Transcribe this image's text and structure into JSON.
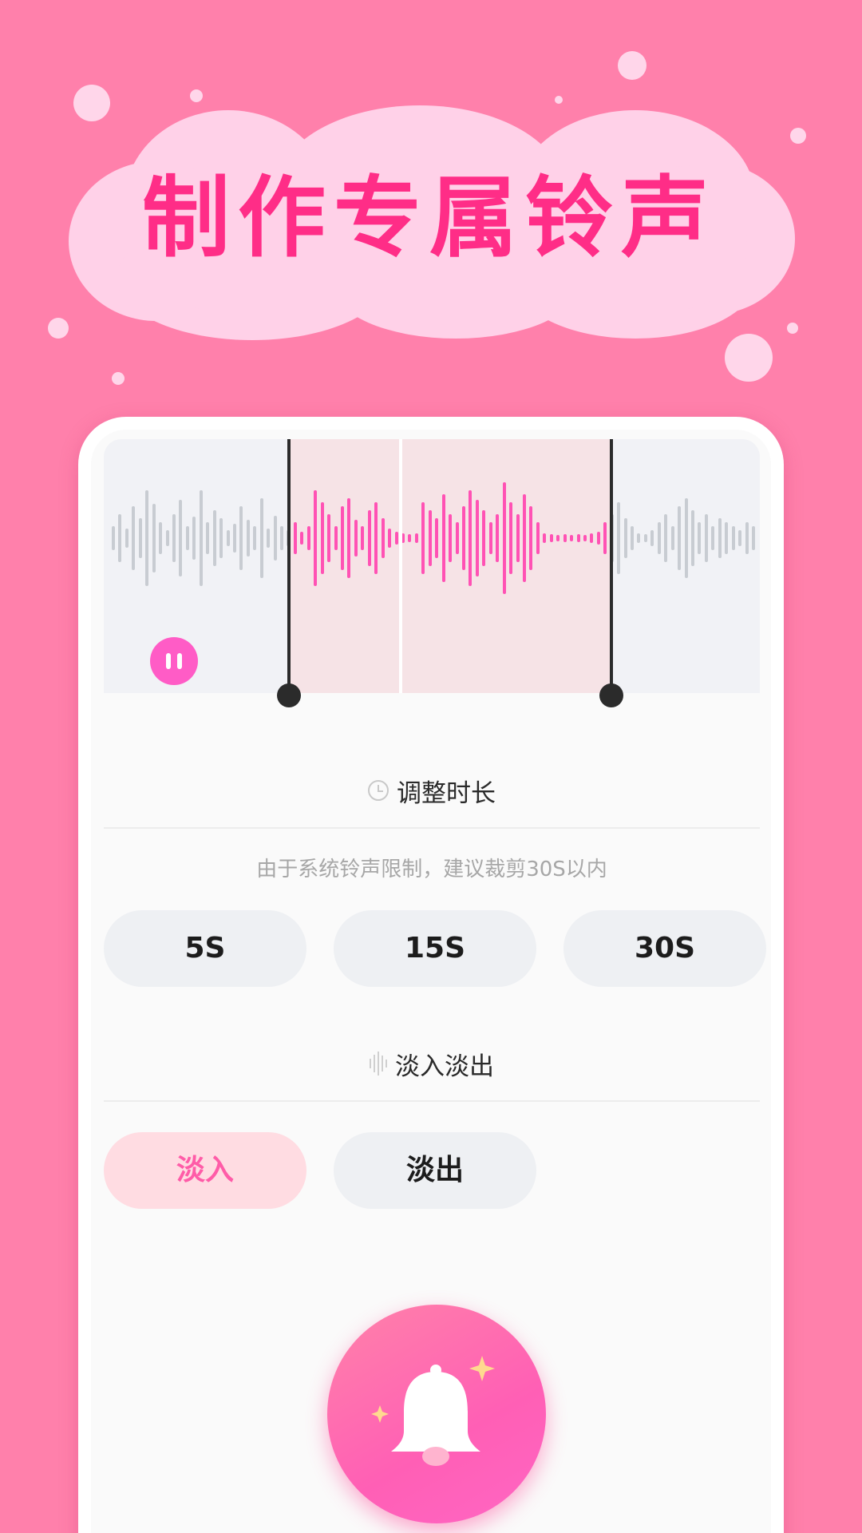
{
  "headline": "制作专属铃声",
  "colors": {
    "background": "#ff80ab",
    "cloud": "#ffd1e8",
    "headline": "#ff2d87",
    "accent": "#ff5cc6",
    "waveform_selected": "#ff52b4",
    "waveform_unselected": "#c8ccd2"
  },
  "waveform": {
    "play_state_icon": "pause-icon",
    "selection_handles": [
      "start-handle",
      "end-handle"
    ]
  },
  "duration_section": {
    "icon": "clock-icon",
    "title": "调整时长",
    "hint": "由于系统铃声限制，建议裁剪30S以内",
    "options": [
      "5S",
      "15S",
      "30S"
    ]
  },
  "fade_section": {
    "icon": "waveform-icon",
    "title": "淡入淡出",
    "options": [
      {
        "label": "淡入",
        "active": true
      },
      {
        "label": "淡出",
        "active": false
      }
    ]
  },
  "action_button": {
    "icon": "bell-sparkle-icon"
  }
}
